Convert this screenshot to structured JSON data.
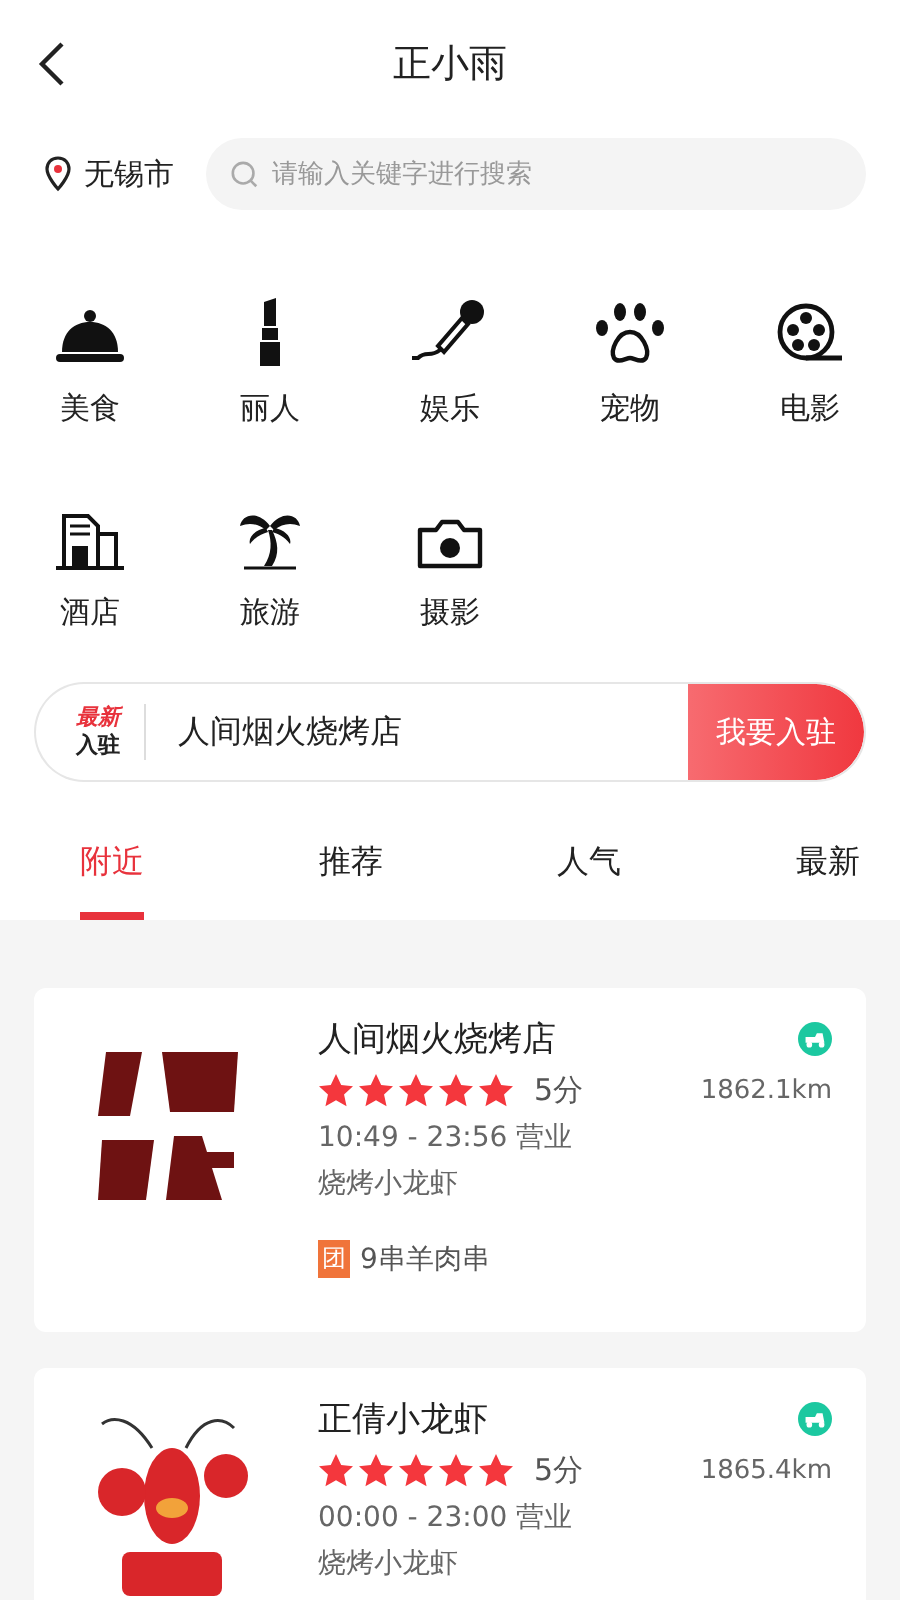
{
  "header": {
    "title": "正小雨"
  },
  "location": {
    "city": "无锡市"
  },
  "search": {
    "placeholder": "请输入关键字进行搜索"
  },
  "categories": [
    {
      "label": "美食"
    },
    {
      "label": "丽人"
    },
    {
      "label": "娱乐"
    },
    {
      "label": "宠物"
    },
    {
      "label": "电影"
    },
    {
      "label": "酒店"
    },
    {
      "label": "旅游"
    },
    {
      "label": "摄影"
    }
  ],
  "banner": {
    "badge_top": "最新",
    "badge_bottom": "入驻",
    "store": "人间烟火烧烤店",
    "button": "我要入驻"
  },
  "tabs": [
    {
      "label": "附近",
      "selected": true
    },
    {
      "label": "推荐",
      "selected": false
    },
    {
      "label": "人气",
      "selected": false
    },
    {
      "label": "最新",
      "selected": false
    }
  ],
  "stores": [
    {
      "name": "人间烟火烧烤店",
      "stars": 5,
      "score": "5分",
      "distance": "1862.1km",
      "hours": "10:49 - 23:56 营业",
      "tags": "烧烤小龙虾",
      "deal_badge": "团",
      "deal": "9串羊肉串"
    },
    {
      "name": "正倩小龙虾",
      "stars": 5,
      "score": "5分",
      "distance": "1865.4km",
      "hours": "00:00 - 23:00 营业",
      "tags": "烧烤小龙虾"
    }
  ]
}
